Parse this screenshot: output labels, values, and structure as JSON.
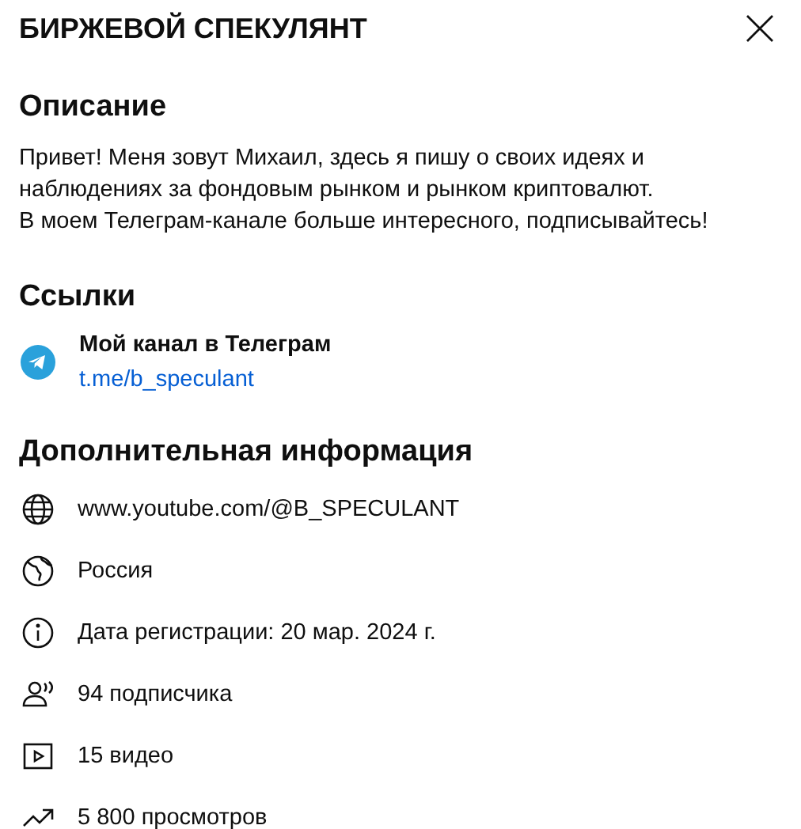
{
  "title": "БИРЖЕВОЙ СПЕКУЛЯНТ",
  "description": {
    "heading": "Описание",
    "lines": [
      "Привет! Меня зовут Михаил, здесь я пишу о своих идеях и наблюдениях за фондовым рынком и рынком криптовалют.",
      "В моем Телеграм-канале больше интересного, подписывайтесь!"
    ]
  },
  "links": {
    "heading": "Ссылки",
    "items": [
      {
        "title": "Мой канал в Телеграм",
        "url": "t.me/b_speculant"
      }
    ]
  },
  "details": {
    "heading": "Дополнительная информация",
    "items": [
      {
        "kind": "globe",
        "text": "www.youtube.com/@B_SPECULANT"
      },
      {
        "kind": "earth",
        "text": "Россия"
      },
      {
        "kind": "info",
        "text": "Дата регистрации: 20 мар. 2024 г."
      },
      {
        "kind": "people",
        "text": "94 подписчика"
      },
      {
        "kind": "video",
        "text": "15 видео"
      },
      {
        "kind": "trend",
        "text": "5 800 просмотров"
      }
    ]
  }
}
